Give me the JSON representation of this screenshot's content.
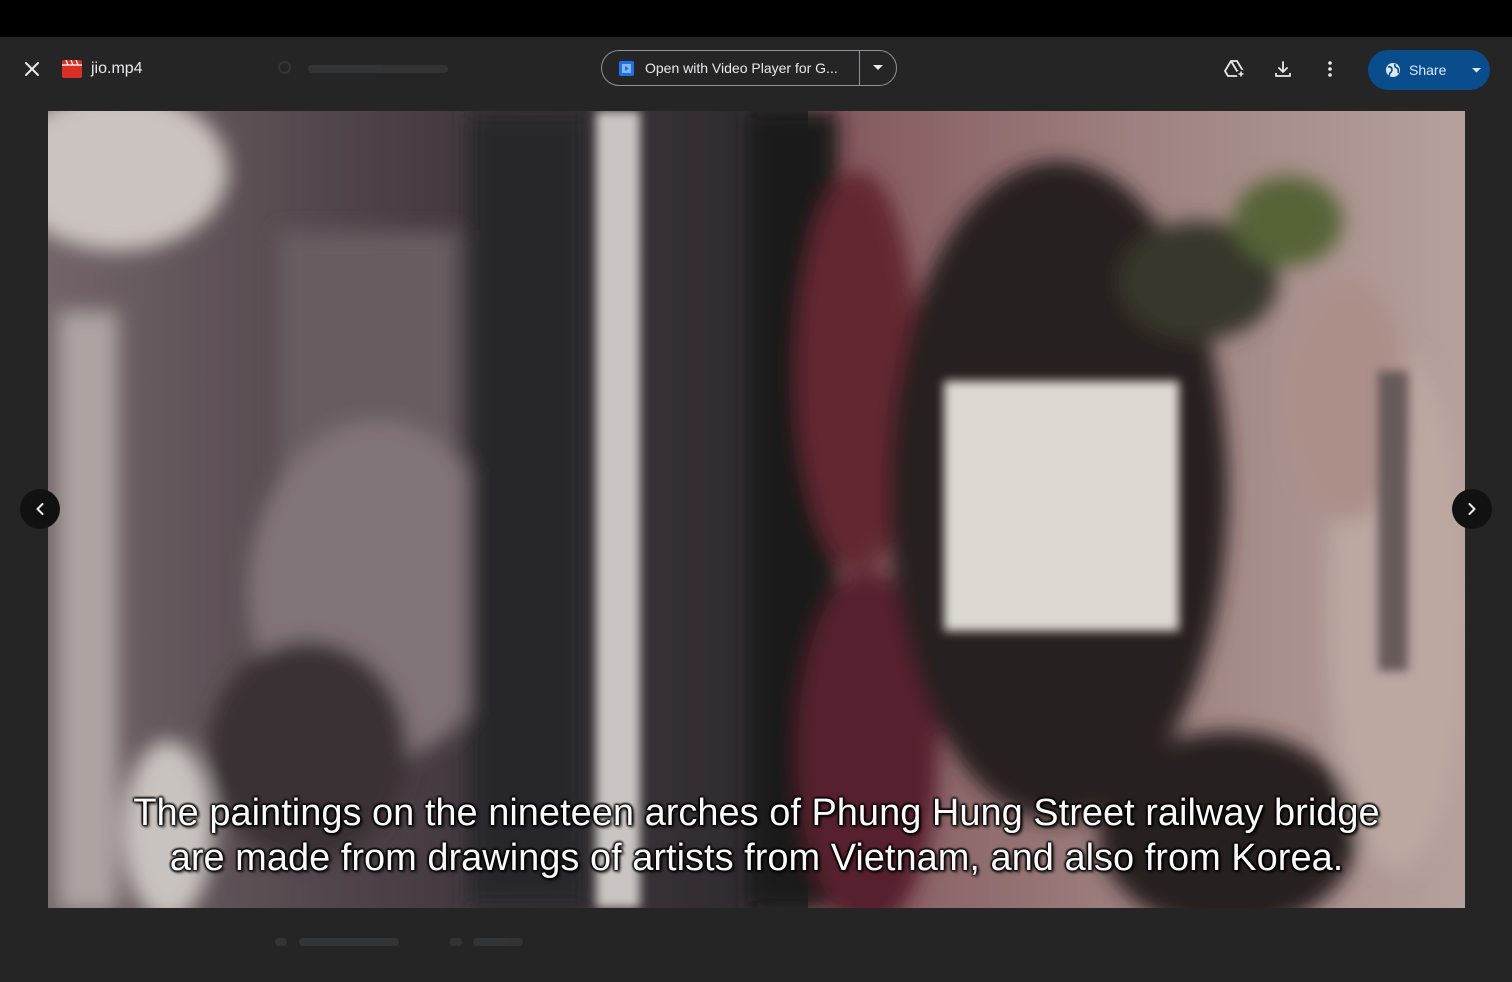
{
  "file": {
    "name": "jio.mp4"
  },
  "open_with": {
    "label": "Open with Video Player for G..."
  },
  "toolbar": {
    "share_label": "Share"
  },
  "video": {
    "subtitle_line1": "The paintings on the nineteen arches of Phung Hung Street railway bridge",
    "subtitle_line2": "are made from drawings of artists from Vietnam, and also from Korea."
  },
  "colors": {
    "viewer_bg": "#252525",
    "share_bg": "#0a4d8c",
    "file_icon": "#d93025"
  }
}
